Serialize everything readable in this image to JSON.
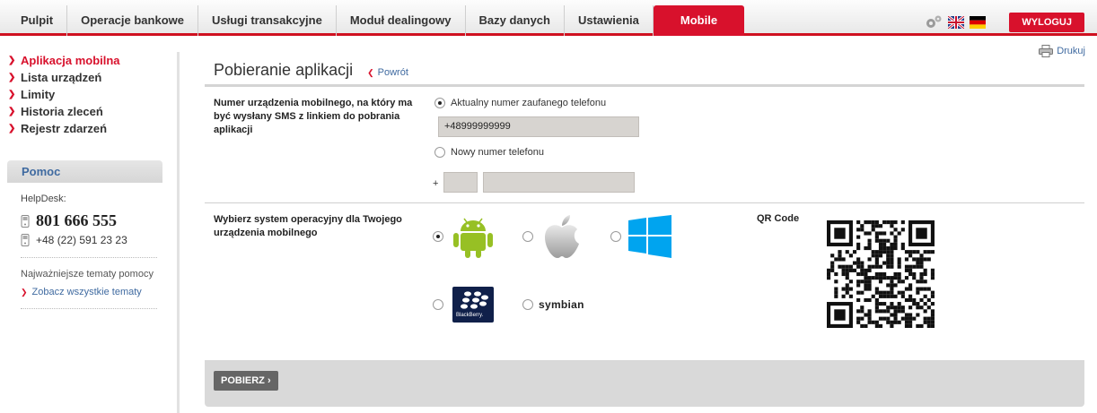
{
  "nav": {
    "tabs": [
      {
        "label": "Pulpit"
      },
      {
        "label": "Operacje bankowe"
      },
      {
        "label": "Usługi transakcyjne"
      },
      {
        "label": "Moduł dealingowy"
      },
      {
        "label": "Bazy danych"
      },
      {
        "label": "Ustawienia"
      },
      {
        "label": "Mobile"
      }
    ],
    "logout_label": "WYLOGUJ"
  },
  "sidebar": {
    "items": [
      {
        "label": "Aplikacja mobilna"
      },
      {
        "label": "Lista urządzeń"
      },
      {
        "label": "Limity"
      },
      {
        "label": "Historia zleceń"
      },
      {
        "label": "Rejestr zdarzeń"
      }
    ],
    "help": {
      "title": "Pomoc",
      "helpdesk_label": "HelpDesk:",
      "phone_main": "801 666 555",
      "phone_alt": "+48 (22) 591 23 23",
      "topics_label": "Najważniejsze tematy pomocy",
      "all_topics_link": "Zobacz wszystkie tematy"
    }
  },
  "main": {
    "print_label": "Drukuj",
    "title": "Pobieranie aplikacji",
    "back_label": "Powrót",
    "phone_section": {
      "label": "Numer urządzenia mobilnego, na który ma być wysłany SMS z linkiem do pobrania aplikacji",
      "option_current": "Aktualny numer zaufanego telefonu",
      "current_number": "+48999999999",
      "option_new": "Nowy numer telefonu",
      "plus_sign": "+",
      "prefix_value": "",
      "number_value": ""
    },
    "os_section": {
      "label": "Wybierz system operacyjny dla Twojego urządzenia mobilnego",
      "symbian_label": "symbian",
      "blackberry_label": "BlackBerry.",
      "qr_label": "QR Code"
    },
    "download_label": "POBIERZ"
  },
  "colors": {
    "brand_red": "#d8112c",
    "link_blue": "#3f6aa0",
    "android_green": "#97c024",
    "windows_blue": "#00a4ef"
  },
  "icons": {
    "gear": "gear-icon",
    "uk_flag": "uk-flag-icon",
    "de_flag": "de-flag-icon",
    "print": "printer-icon",
    "phone": "phone-icon"
  }
}
